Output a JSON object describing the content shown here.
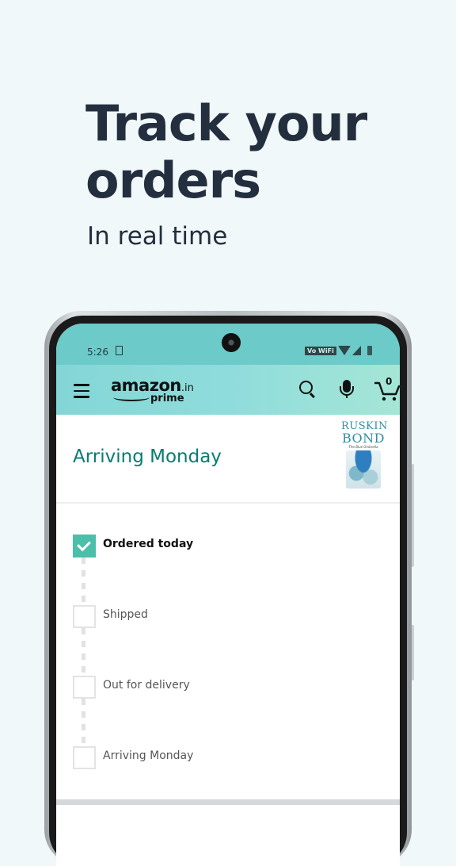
{
  "hero": {
    "headline_line1": "Track your",
    "headline_line2": "orders",
    "subheadline": "In real time"
  },
  "status_bar": {
    "time": "5:26",
    "network_label": "Vo WiFi",
    "icons": [
      "download-icon",
      "wifi-icon",
      "signal-icon",
      "battery-icon"
    ]
  },
  "app_bar": {
    "logo_text": "amazon",
    "logo_tld": ".in",
    "logo_tag": "prime",
    "cart_count": "0",
    "icons": [
      "menu-icon",
      "search-icon",
      "mic-icon",
      "cart-icon"
    ]
  },
  "order": {
    "arrival_title": "Arriving Monday",
    "product": {
      "author_line1": "RUSKIN",
      "author_line2": "BOND",
      "book_subtitle": "The Blue Umbrella"
    },
    "steps": [
      {
        "label": "Ordered today",
        "done": true
      },
      {
        "label": "Shipped",
        "done": false
      },
      {
        "label": "Out for delivery",
        "done": false
      },
      {
        "label": "Arriving Monday",
        "done": false
      }
    ]
  },
  "colors": {
    "headline": "#232f3e",
    "accent_teal": "#067d6f",
    "check_fill": "#4cbfaa",
    "status_bar": "#6ccac9",
    "page_bg": "#f1f8f9"
  }
}
